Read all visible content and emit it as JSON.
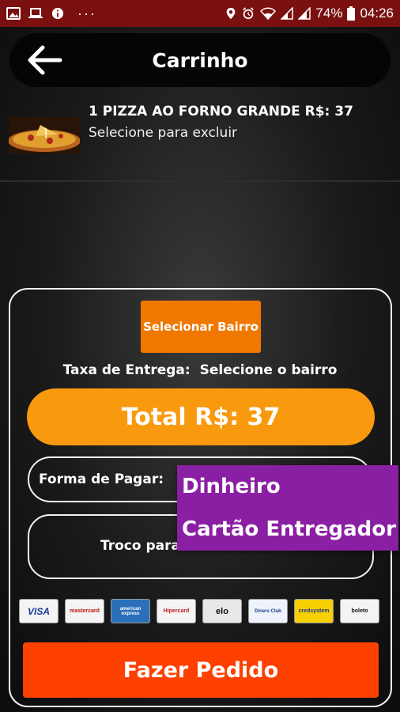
{
  "status_bar": {
    "battery": "74%",
    "time": "04:26",
    "dots": "···"
  },
  "header": {
    "title": "Carrinho",
    "back_icon": "arrow-left-icon"
  },
  "cart": {
    "items": [
      {
        "name": "1 PIZZA AO FORNO GRANDE R$: 37",
        "hint": "Selecione para excluir",
        "thumbnail": "pizza-image"
      }
    ]
  },
  "order": {
    "bairro_button": "Selecionar Bairro",
    "taxa_label": "Taxa de Entrega:",
    "taxa_value": "Selecione o bairro",
    "total_label": "Total R$: 37",
    "payment_label": "Forma de Pagar:",
    "troco_label": "Troco para:",
    "troco_value": "",
    "submit_button": "Fazer Pedido"
  },
  "payment_dropdown": {
    "options": [
      "Dinheiro",
      "Cartão Entregador"
    ]
  },
  "card_brands": [
    "VISA",
    "mastercard",
    "american express",
    "Hipercard",
    "elo",
    "Diners Club",
    "credsystem",
    "boleto"
  ],
  "colors": {
    "status_bar": "#7a1010",
    "bairro_button": "#f07800",
    "total_pill": "#f9990d",
    "dropdown": "#8b1fa3",
    "order_button": "#fe4000"
  }
}
